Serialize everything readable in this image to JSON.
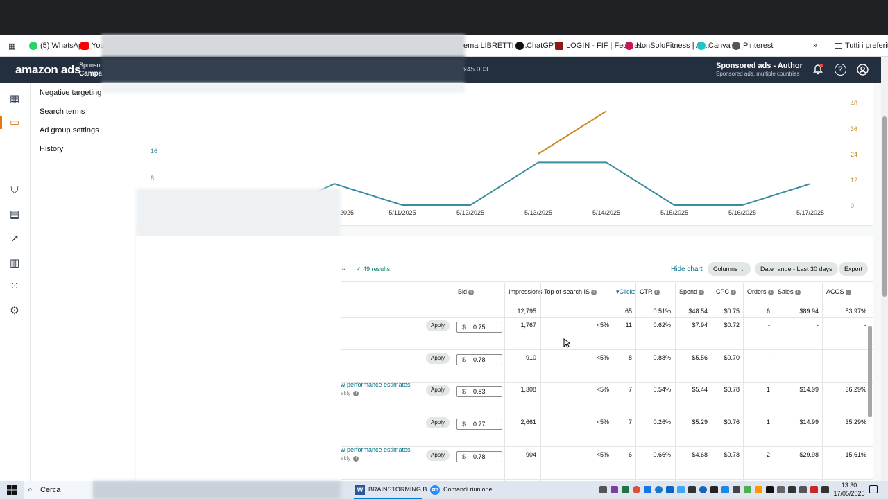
{
  "bookmarks": [
    {
      "label": "(5) WhatsApp"
    },
    {
      "label": "You"
    },
    {
      "label": "ema LIBRETTI A..."
    },
    {
      "label": "ChatGPT"
    },
    {
      "label": "LOGIN - FIF | Federa..."
    },
    {
      "label": "NonSoloFitness | Ar..."
    },
    {
      "label": "Canva"
    },
    {
      "label": "Pinterest"
    }
  ],
  "bookmarks_more": "»",
  "bookmarks_all": "Tutti i preferiti",
  "header": {
    "logo": "amazon ads",
    "crumb_top": "Sponsor",
    "crumb_bottom": "Campa",
    "mid_text": "x45.003",
    "account_title": "Sponsored ads - Author",
    "account_sub": "Sponsored ads, multiple countries"
  },
  "subnav": {
    "items": [
      "Negative targeting",
      "Search terms",
      "Ad group settings",
      "History"
    ]
  },
  "chart_data": {
    "type": "line",
    "x": [
      "5/11/2025",
      "5/12/2025",
      "5/13/2025",
      "5/14/2025",
      "5/15/2025",
      "5/16/2025",
      "5/17/2025"
    ],
    "x_partial_label": "2025",
    "left_axis_ticks": [
      "16",
      "8"
    ],
    "right_axis_ticks": [
      "48",
      "36",
      "24",
      "12",
      "0"
    ],
    "series": [
      {
        "color": "#3a8ca0",
        "values": [
          0,
          0,
          20,
          20,
          0,
          0,
          10
        ]
      },
      {
        "color": "#c7881e",
        "values": [
          null,
          null,
          24,
          44,
          null,
          null,
          null
        ]
      }
    ],
    "series_prev_point": {
      "label": "5/10/2025",
      "value": 10
    }
  },
  "toolbar": {
    "results": "49 results",
    "hide_chart": "Hide chart",
    "columns": "Columns",
    "date_range": "Date range - Last 30 days",
    "export": "Export"
  },
  "table": {
    "headers": [
      "Bid",
      "Impressions",
      "Top-of-search IS",
      "Clicks",
      "CTR",
      "Spend",
      "CPC",
      "Orders",
      "Sales",
      "ACOS"
    ],
    "totals": {
      "impressions": "12,795",
      "clicks": "65",
      "ctr": "0.51%",
      "spend": "$48.54",
      "cpc": "$0.75",
      "orders": "6",
      "sales": "$89.94",
      "acos": "53.97%"
    },
    "apply_label": "Apply",
    "currency": "$",
    "estimate_link": "w performance estimates",
    "estimate_sub": "ekly",
    "rows": [
      {
        "bid": "0.75",
        "impressions": "1,767",
        "tos": "<5%",
        "clicks": "11",
        "ctr": "0.62%",
        "spend": "$7.94",
        "cpc": "$0.72",
        "orders": "-",
        "sales": "-",
        "acos": "-"
      },
      {
        "bid": "0.78",
        "impressions": "910",
        "tos": "<5%",
        "clicks": "8",
        "ctr": "0.88%",
        "spend": "$5.56",
        "cpc": "$0.70",
        "orders": "-",
        "sales": "-",
        "acos": "-"
      },
      {
        "bid": "0.83",
        "impressions": "1,308",
        "tos": "<5%",
        "clicks": "7",
        "ctr": "0.54%",
        "spend": "$5.44",
        "cpc": "$0.78",
        "orders": "1",
        "sales": "$14.99",
        "acos": "36.29%"
      },
      {
        "bid": "0.77",
        "impressions": "2,661",
        "tos": "<5%",
        "clicks": "7",
        "ctr": "0.26%",
        "spend": "$5.29",
        "cpc": "$0.76",
        "orders": "1",
        "sales": "$14.99",
        "acos": "35.29%"
      },
      {
        "bid": "0.78",
        "impressions": "904",
        "tos": "<5%",
        "clicks": "6",
        "ctr": "0.66%",
        "spend": "$4.68",
        "cpc": "$0.78",
        "orders": "2",
        "sales": "$29.98",
        "acos": "15.61%"
      }
    ]
  },
  "taskbar": {
    "search": "Cerca",
    "app1": "BRAINSTORMING B...",
    "app2": "Comandi riunione ...",
    "time": "13:30",
    "date": "17/05/2025"
  },
  "colors": {
    "accent": "#007185",
    "header_bg": "#232f3e",
    "line_teal": "#3a8ca0",
    "line_orange": "#c7881e",
    "green": "#067d62"
  }
}
